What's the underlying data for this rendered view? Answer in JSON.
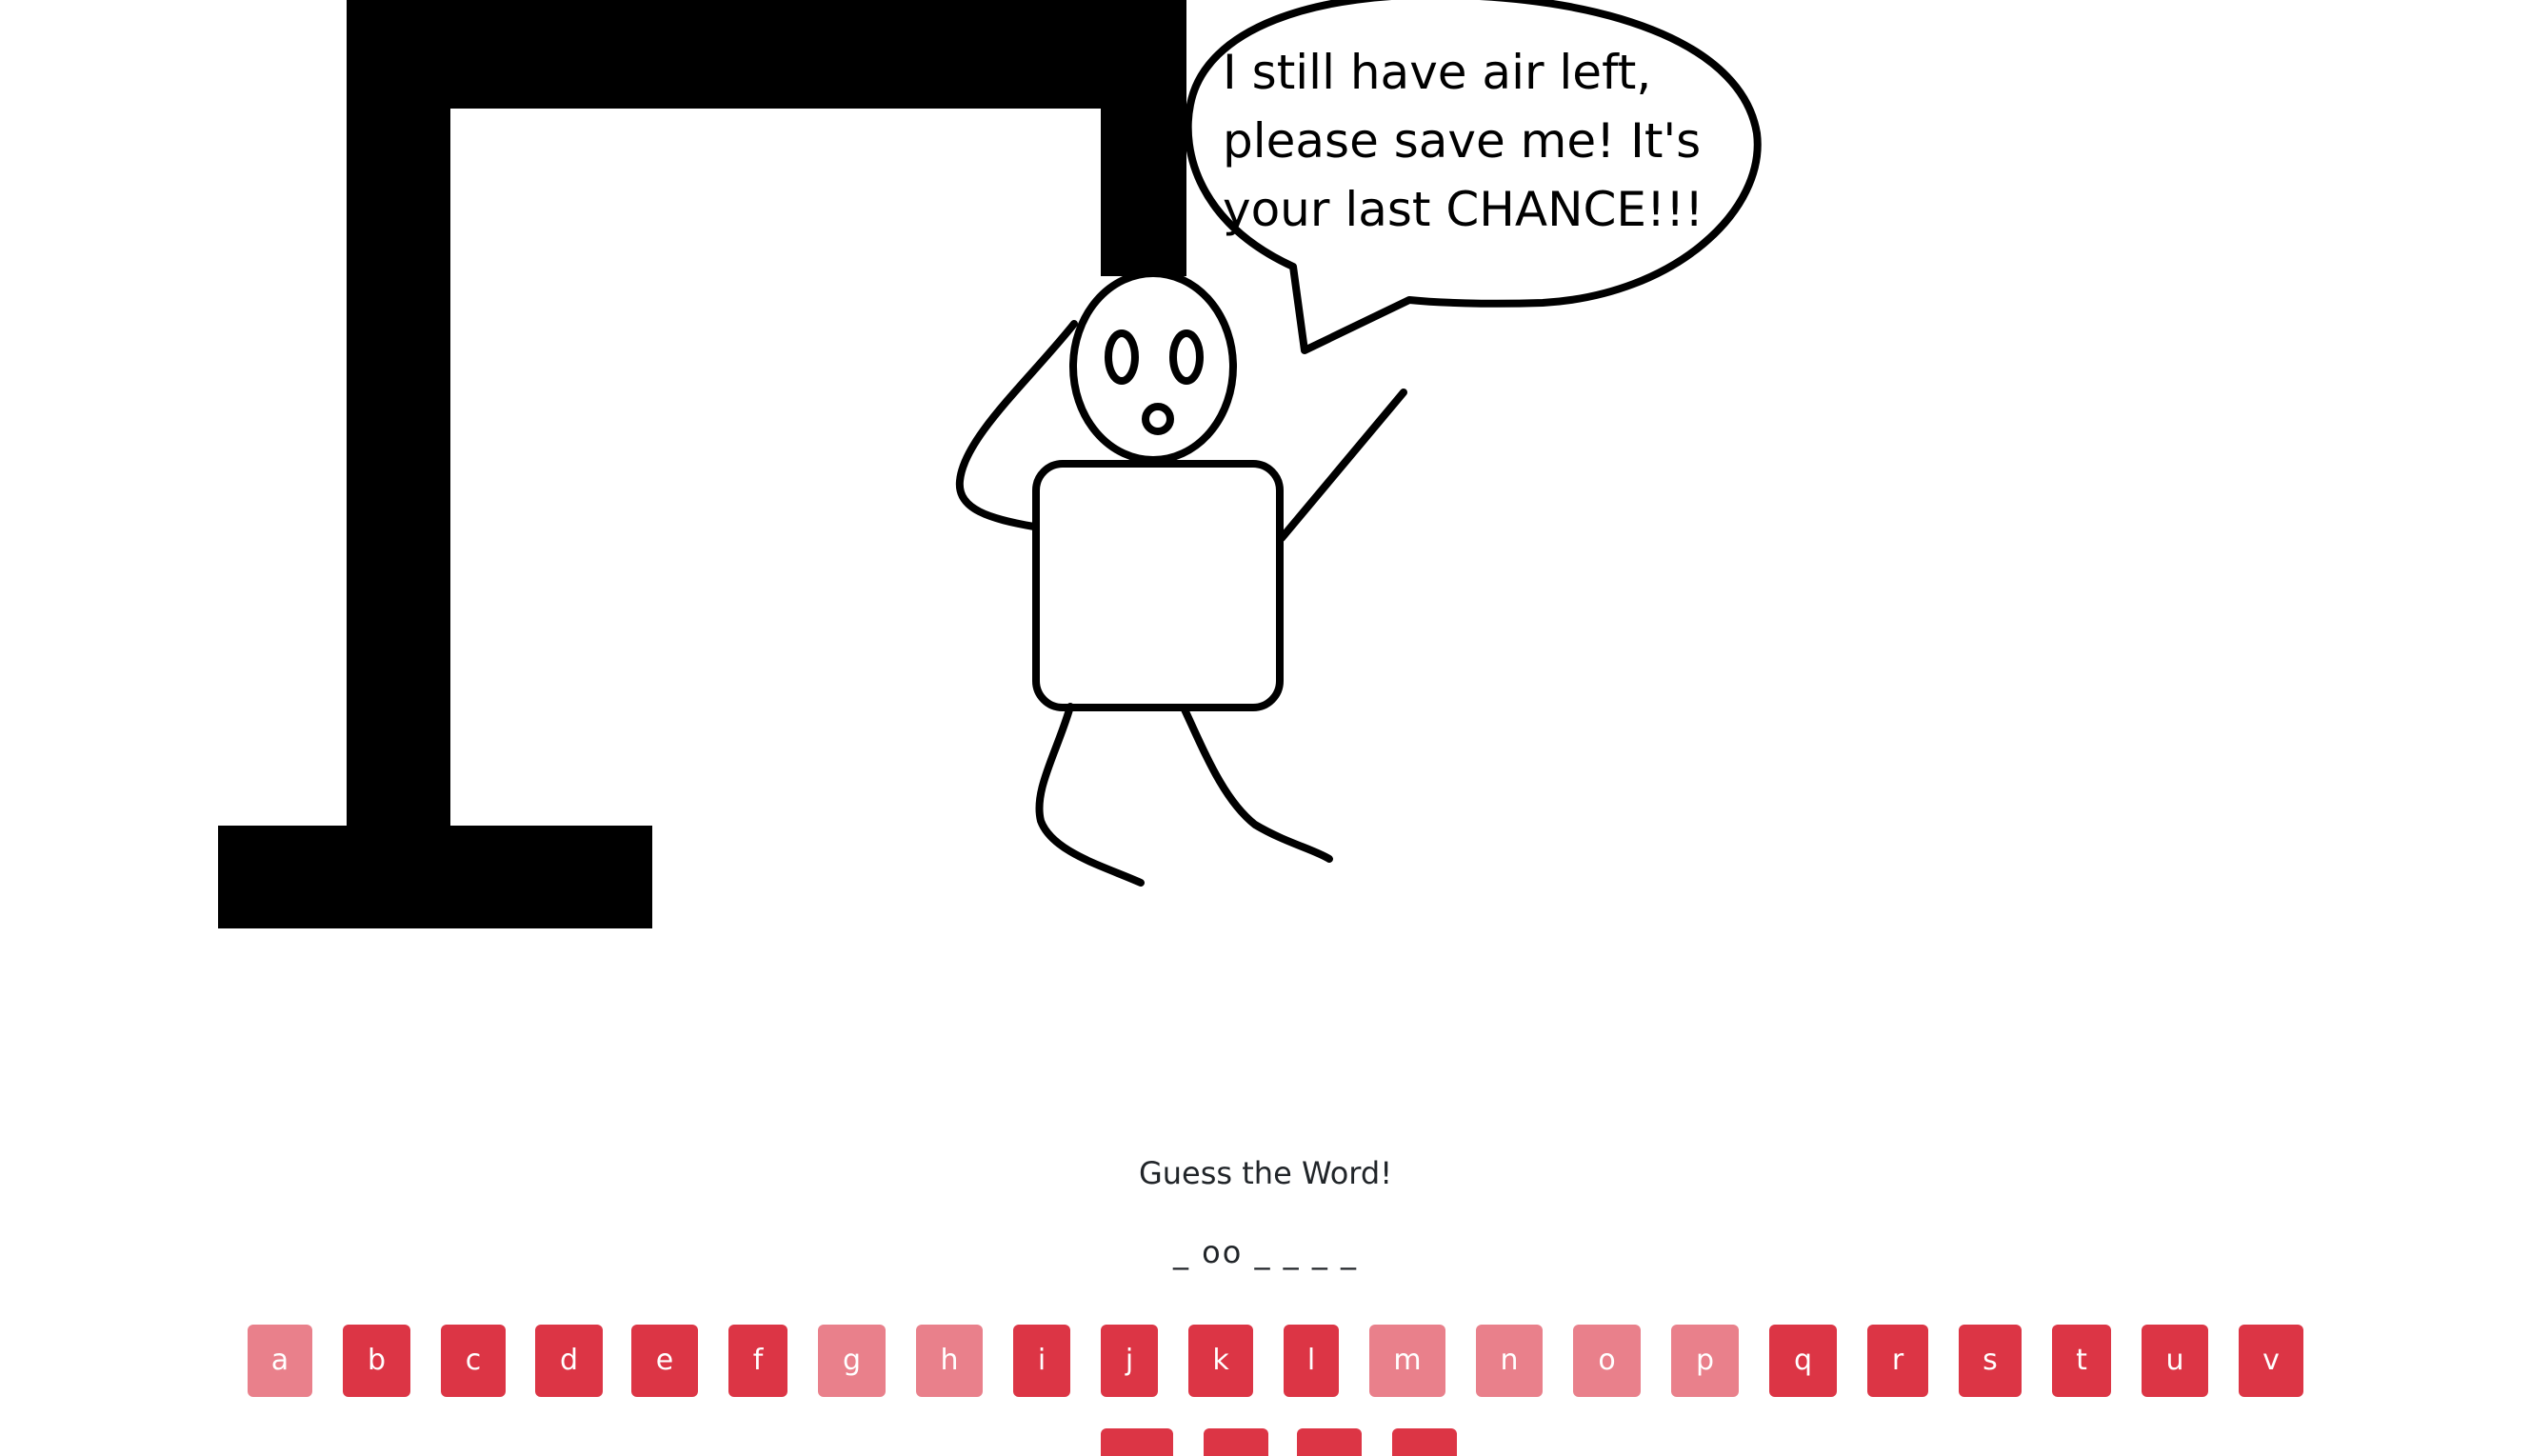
{
  "speech": {
    "lines": [
      "I still have air left,",
      "please save me! It's",
      "your last CHANCE!!!"
    ]
  },
  "game": {
    "prompt": "Guess the Word!",
    "word_display": "_ oo _ _ _ _"
  },
  "keyboard": {
    "keys": [
      {
        "letter": "a",
        "state": "used"
      },
      {
        "letter": "b",
        "state": "active"
      },
      {
        "letter": "c",
        "state": "active"
      },
      {
        "letter": "d",
        "state": "active"
      },
      {
        "letter": "e",
        "state": "active"
      },
      {
        "letter": "f",
        "state": "active"
      },
      {
        "letter": "g",
        "state": "used"
      },
      {
        "letter": "h",
        "state": "used"
      },
      {
        "letter": "i",
        "state": "active"
      },
      {
        "letter": "j",
        "state": "active"
      },
      {
        "letter": "k",
        "state": "active"
      },
      {
        "letter": "l",
        "state": "active"
      },
      {
        "letter": "m",
        "state": "used"
      },
      {
        "letter": "n",
        "state": "used"
      },
      {
        "letter": "o",
        "state": "used"
      },
      {
        "letter": "p",
        "state": "used"
      },
      {
        "letter": "q",
        "state": "active"
      },
      {
        "letter": "r",
        "state": "active"
      },
      {
        "letter": "s",
        "state": "active"
      },
      {
        "letter": "t",
        "state": "active"
      },
      {
        "letter": "u",
        "state": "active"
      },
      {
        "letter": "v",
        "state": "active"
      }
    ]
  },
  "colors": {
    "key_active": "#dc3545",
    "key_used": "#e9808b"
  }
}
